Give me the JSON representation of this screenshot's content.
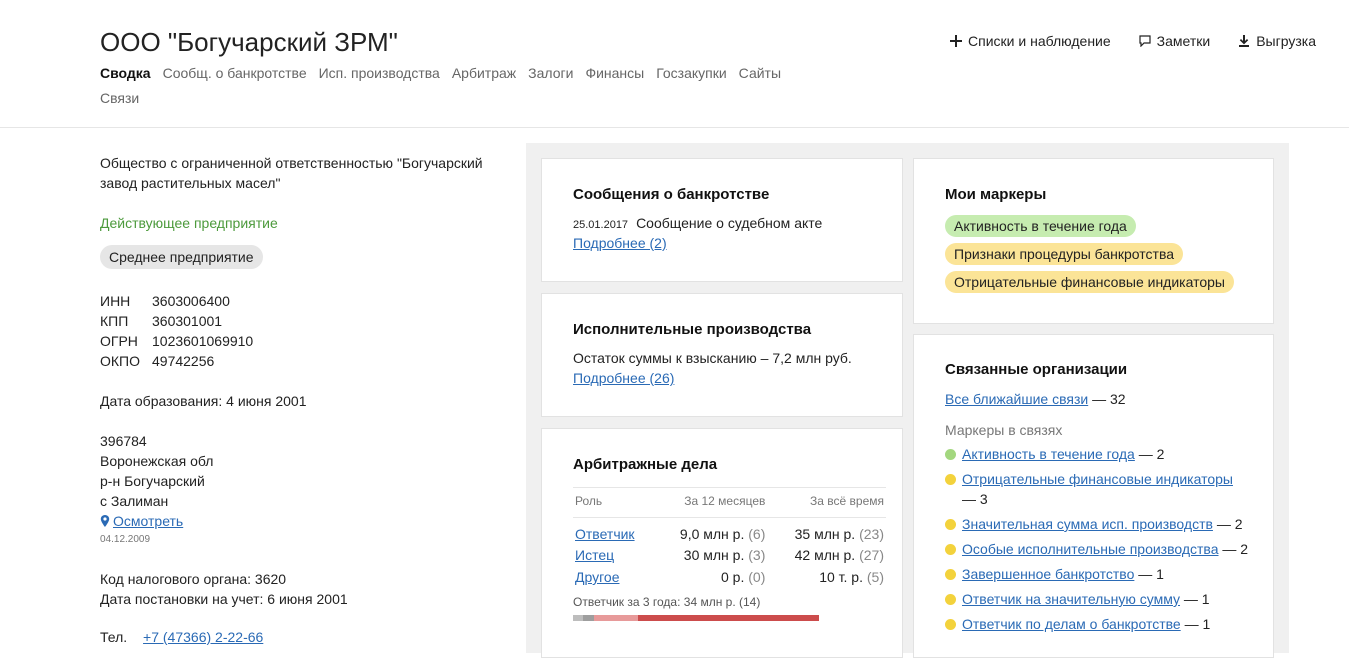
{
  "header": {
    "title": "ООО \"Богучарский ЗРМ\"",
    "actions": {
      "lists": "Списки и наблюдение",
      "notes": "Заметки",
      "export": "Выгрузка"
    },
    "tabs": [
      "Сводка",
      "Сообщ. о банкротстве",
      "Исп. производства",
      "Арбитраж",
      "Залоги",
      "Финансы",
      "Госзакупки",
      "Сайты",
      "Связи"
    ]
  },
  "left": {
    "full_name": "Общество с ограниченной ответственностью \"Богучарский завод растительных масел\"",
    "status": "Действующее предприятие",
    "size": "Среднее предприятие",
    "ids": [
      {
        "k": "ИНН",
        "v": "3603006400"
      },
      {
        "k": "КПП",
        "v": "360301001"
      },
      {
        "k": "ОГРН",
        "v": "1023601069910"
      },
      {
        "k": "ОКПО",
        "v": "49742256"
      }
    ],
    "foundation": "Дата образования: 4 июня 2001",
    "address": [
      "396784",
      "Воронежская обл",
      "р-н Богучарский",
      "с Залиман"
    ],
    "map_link": "Осмотреть",
    "address_date": "04.12.2009",
    "tax_code": "Код налогового органа: 3620",
    "tax_date": "Дата постановки на учет: 6 июня 2001",
    "phone_label": "Тел.",
    "phone": "+7 (47366) 2-22-66"
  },
  "bankruptcy": {
    "title": "Сообщения о банкротстве",
    "date": "25.01.2017",
    "text": "Сообщение о судебном акте",
    "more": "Подробнее (2)"
  },
  "enforcement": {
    "title": "Исполнительные производства",
    "text": "Остаток суммы к взысканию – 7,2 млн руб.",
    "more": "Подробнее (26)"
  },
  "arbitration": {
    "title": "Арбитражные дела",
    "headers": {
      "role": "Роль",
      "year": "За 12 месяцев",
      "all": "За всё время"
    },
    "rows": [
      {
        "role": "Ответчик",
        "year": "9,0 млн р.",
        "year_cnt": "(6)",
        "all": "35 млн р.",
        "all_cnt": "(23)"
      },
      {
        "role": "Истец",
        "year": "30 млн р.",
        "year_cnt": "(3)",
        "all": "42 млн р.",
        "all_cnt": "(27)"
      },
      {
        "role": "Другое",
        "year": "0 р.",
        "year_cnt": "(0)",
        "all": "10 т. р.",
        "all_cnt": "(5)"
      }
    ],
    "note": "Ответчик за 3 года: 34 млн р. (14)",
    "bar_colors": [
      "#bdbdbd",
      "#9e9e9e",
      "#e79a9a",
      "#cc4c4c"
    ]
  },
  "markers": {
    "title": "Мои маркеры",
    "items": [
      {
        "label": "Активность в течение года",
        "color": "green"
      },
      {
        "label": "Признаки процедуры банкротства",
        "color": "yellow"
      },
      {
        "label": "Отрицательные финансовые индикаторы",
        "color": "yellow"
      }
    ]
  },
  "related": {
    "title": "Связанные организации",
    "all_link": "Все ближайшие связи",
    "all_count": "— 32",
    "sub": "Маркеры в связях",
    "items": [
      {
        "label": "Активность в течение года",
        "count": "— 2",
        "color": "#a3d77f"
      },
      {
        "label": "Отрицательные финансовые индикаторы",
        "count": "— 3",
        "color": "#f3d23c"
      },
      {
        "label": "Значительная сумма исп. производств",
        "count": "— 2",
        "color": "#f3d23c"
      },
      {
        "label": "Особые исполнительные производства",
        "count": "— 2",
        "color": "#f3d23c"
      },
      {
        "label": "Завершенное банкротство",
        "count": "— 1",
        "color": "#f3d23c"
      },
      {
        "label": "Ответчик на значительную сумму",
        "count": "— 1",
        "color": "#f3d23c"
      },
      {
        "label": "Ответчик по делам о банкротстве",
        "count": "— 1",
        "color": "#f3d23c"
      }
    ]
  }
}
